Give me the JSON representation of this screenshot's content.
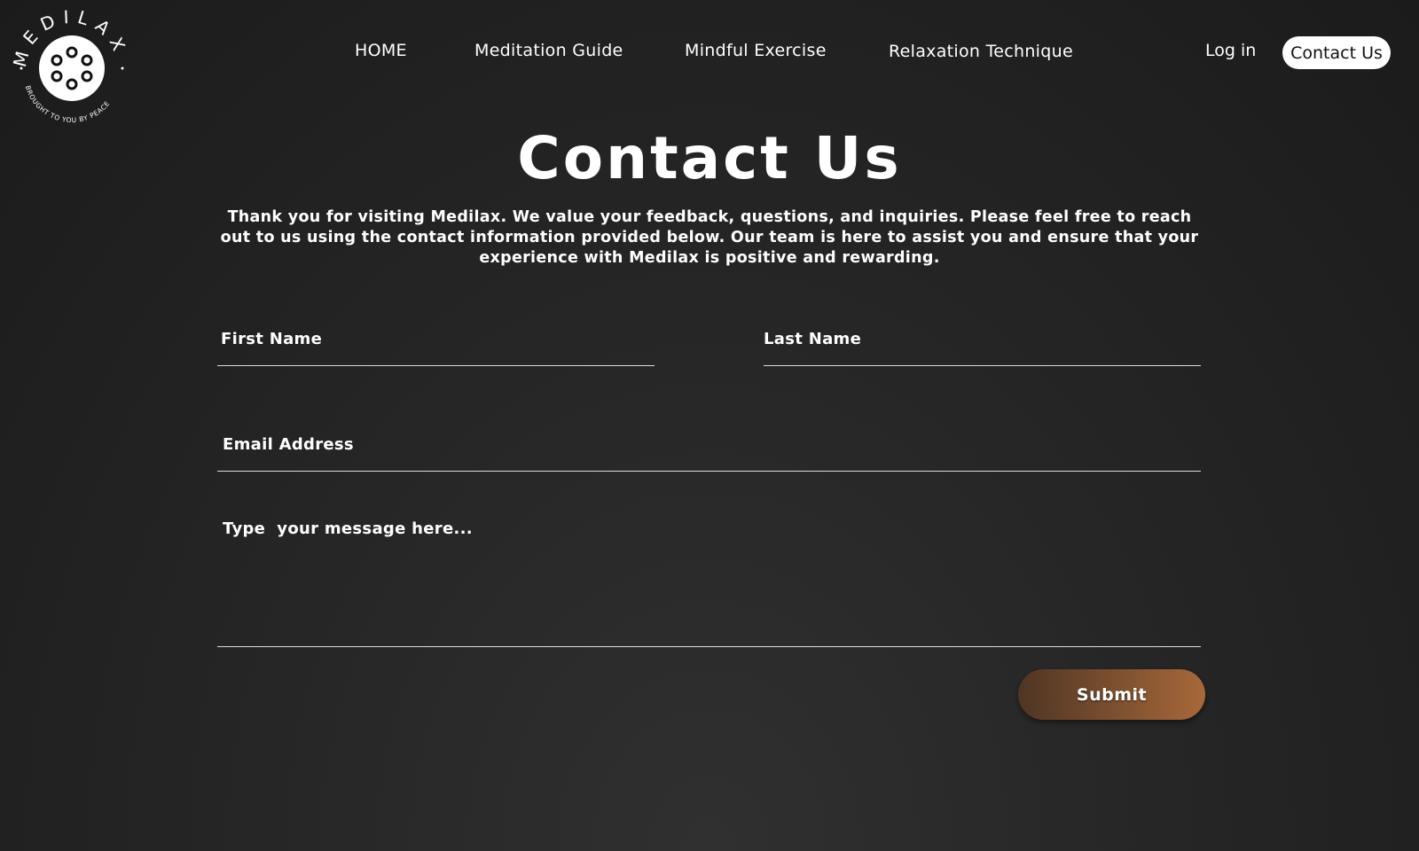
{
  "brand": {
    "name": "MEDILAX",
    "tagline": "BROUGHT TO YOU BY PEACE"
  },
  "nav": {
    "items": [
      {
        "label": "HOME"
      },
      {
        "label": "Meditation Guide"
      },
      {
        "label": "Mindful Exercise"
      },
      {
        "label": "Relaxation Technique"
      }
    ],
    "login": "Log in",
    "contact": "Contact Us"
  },
  "page": {
    "title": "Contact Us",
    "intro": "Thank you for visiting Medilax. We value your feedback, questions, and inquiries. Please feel free to reach out to us using the contact information provided below. Our team is here to assist you and ensure that your experience with Medilax is positive and rewarding."
  },
  "form": {
    "first_name_label": "First Name",
    "last_name_label": "Last Name",
    "email_label": "Email Address",
    "message_placeholder": "Type  your message here...",
    "submit_label": "Submit"
  },
  "colors": {
    "background": "#1e1e1e",
    "button_gradient_start": "#4f3523",
    "button_gradient_end": "#a8683a",
    "pill_bg": "#ffffff"
  }
}
